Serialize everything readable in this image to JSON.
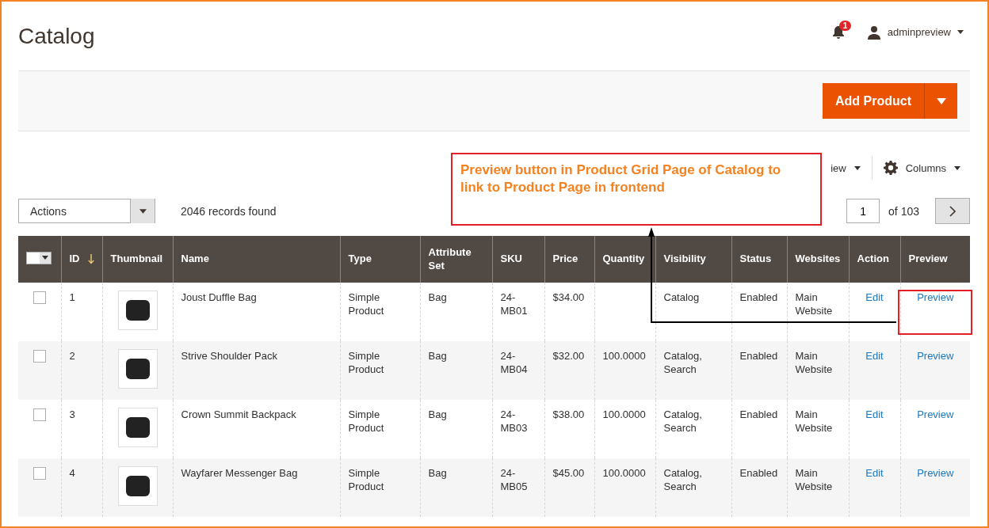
{
  "page_title": "Catalog",
  "header": {
    "notifications_count": "1",
    "user": "adminpreview"
  },
  "add_button": "Add Product",
  "toolbar": {
    "view_label": "iew",
    "columns_label": "Columns"
  },
  "actions_select": "Actions",
  "records_found": "2046 records found",
  "pager": {
    "page": "1",
    "of": "of 103"
  },
  "table": {
    "columns": [
      {
        "label": "ID",
        "sorted": true
      },
      {
        "label": "Thumbnail",
        "sorted": false
      },
      {
        "label": "Name",
        "sorted": false
      },
      {
        "label": "Type",
        "sorted": false
      },
      {
        "label": "Attribute Set",
        "sorted": false
      },
      {
        "label": "SKU",
        "sorted": false
      },
      {
        "label": "Price",
        "sorted": false
      },
      {
        "label": "Quantity",
        "sorted": false
      },
      {
        "label": "Visibility",
        "sorted": false
      },
      {
        "label": "Status",
        "sorted": false
      },
      {
        "label": "Websites",
        "sorted": false
      },
      {
        "label": "Action",
        "sorted": false
      },
      {
        "label": "Preview",
        "sorted": false
      }
    ],
    "rows": [
      {
        "checked": false,
        "id": "1",
        "name": "Joust Duffle Bag",
        "type": "Simple Product",
        "attribute_set": "Bag",
        "sku": "24-MB01",
        "price": "$34.00",
        "quantity": "",
        "visibility": "Catalog",
        "status": "Enabled",
        "websites": "Main Website",
        "action": "Edit",
        "preview": "Preview"
      },
      {
        "checked": false,
        "id": "2",
        "name": "Strive Shoulder Pack",
        "type": "Simple Product",
        "attribute_set": "Bag",
        "sku": "24-MB04",
        "price": "$32.00",
        "quantity": "100.0000",
        "visibility": "Catalog, Search",
        "status": "Enabled",
        "websites": "Main Website",
        "action": "Edit",
        "preview": "Preview"
      },
      {
        "checked": false,
        "id": "3",
        "name": "Crown Summit Backpack",
        "type": "Simple Product",
        "attribute_set": "Bag",
        "sku": "24-MB03",
        "price": "$38.00",
        "quantity": "100.0000",
        "visibility": "Catalog, Search",
        "status": "Enabled",
        "websites": "Main Website",
        "action": "Edit",
        "preview": "Preview"
      },
      {
        "checked": false,
        "id": "4",
        "name": "Wayfarer Messenger Bag",
        "type": "Simple Product",
        "attribute_set": "Bag",
        "sku": "24-MB05",
        "price": "$45.00",
        "quantity": "100.0000",
        "visibility": "Catalog, Search",
        "status": "Enabled",
        "websites": "Main Website",
        "action": "Edit",
        "preview": "Preview"
      }
    ]
  },
  "annotation": {
    "text": "Preview button in Product Grid Page of Catalog to link to Product Page in frontend"
  }
}
